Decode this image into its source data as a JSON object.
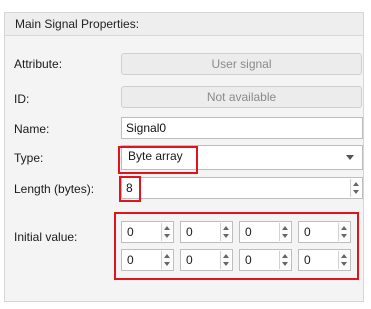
{
  "group_title": "Main Signal Properties:",
  "attribute": {
    "label": "Attribute:",
    "value": "User signal"
  },
  "id": {
    "label": "ID:",
    "value": "Not available"
  },
  "name": {
    "label": "Name:",
    "value": "Signal0"
  },
  "type": {
    "label": "Type:",
    "value": "Byte array"
  },
  "length": {
    "label": "Length (bytes):",
    "value": "8"
  },
  "initial_value": {
    "label": "Initial value:",
    "bytes": [
      "0",
      "0",
      "0",
      "0",
      "0",
      "0",
      "0",
      "0"
    ]
  },
  "highlight_color": "#e0151b"
}
